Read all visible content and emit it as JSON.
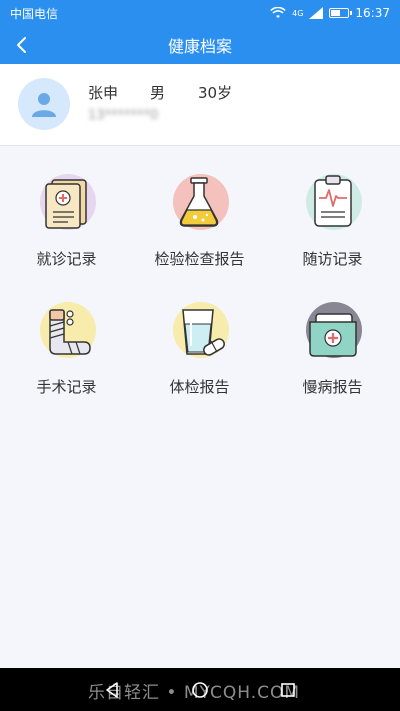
{
  "status": {
    "carrier": "中国电信",
    "time": "16:37",
    "network": "4G"
  },
  "nav": {
    "title": "健康档案"
  },
  "profile": {
    "name": "张申",
    "sex": "男",
    "age": "30岁",
    "phone": "13*******0"
  },
  "tiles": [
    {
      "label": "就诊记录",
      "icon": "medical-record-icon",
      "accent": "#e6d6ef"
    },
    {
      "label": "检验检查报告",
      "icon": "lab-flask-icon",
      "accent": "#f5c1bd"
    },
    {
      "label": "随访记录",
      "icon": "clipboard-ecg-icon",
      "accent": "#cfece4"
    },
    {
      "label": "手术记录",
      "icon": "bandaged-arm-icon",
      "accent": "#f7ecab"
    },
    {
      "label": "体检报告",
      "icon": "water-glass-pill-icon",
      "accent": "#f7ecab"
    },
    {
      "label": "慢病报告",
      "icon": "medical-folder-icon",
      "accent": "#8a8794"
    }
  ],
  "watermark": "乐自轻汇 • MYCQH.COM",
  "colors": {
    "primary": "#2b8ff0",
    "background": "#f4f6fb"
  }
}
